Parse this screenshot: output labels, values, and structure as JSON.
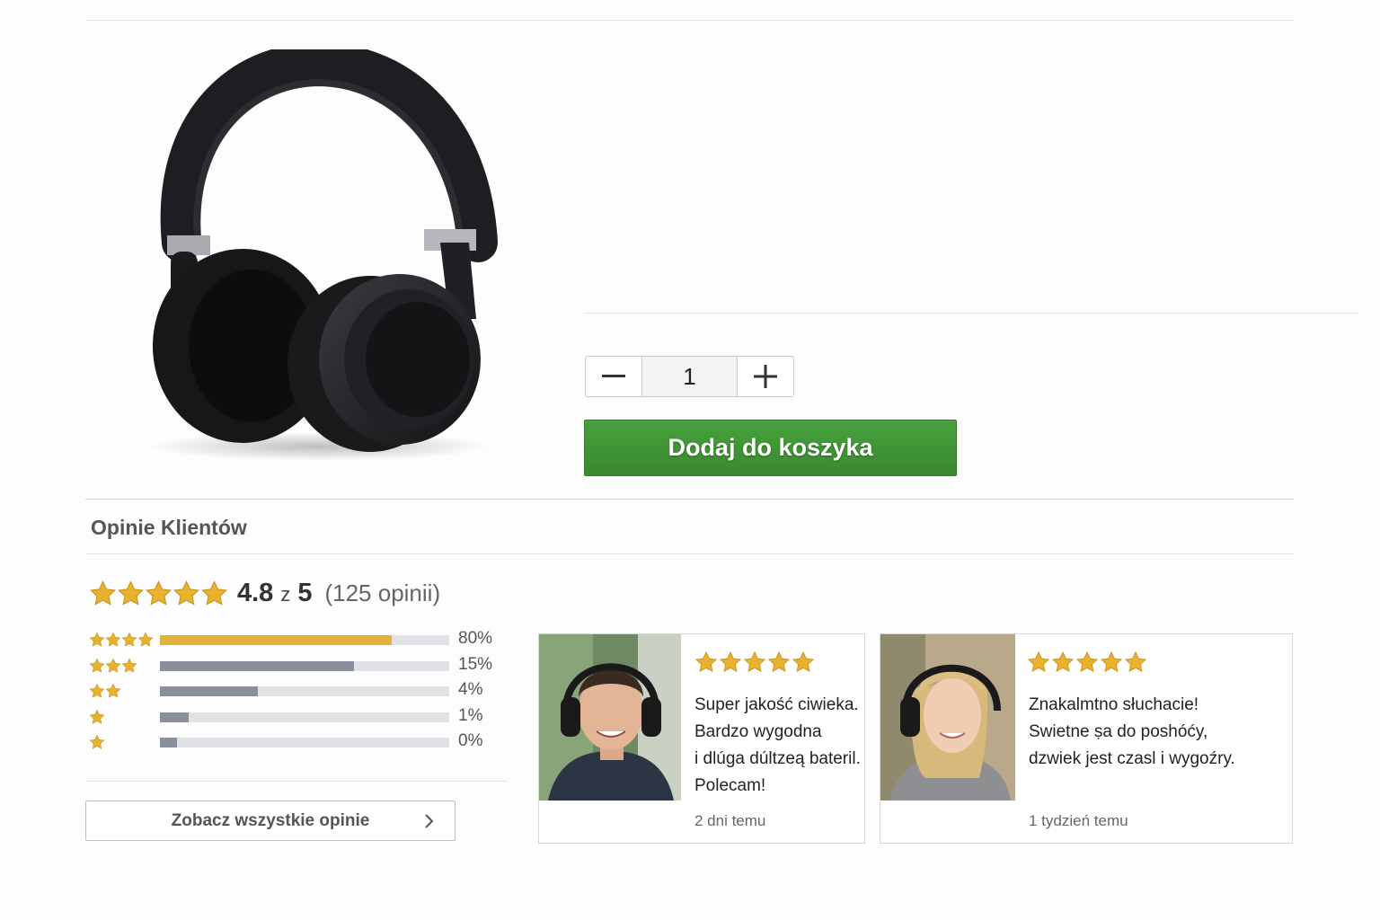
{
  "product": {
    "image_alt": "headphones",
    "quantity": "1",
    "decrement_symbol": "−",
    "increment_symbol": "+",
    "add_to_cart_label": "Dodaj do koszyka"
  },
  "reviews": {
    "section_title": "Opinie Klientów",
    "average": "4.8",
    "of_label": "z",
    "max": "5",
    "count_label": "(125 opinii)",
    "distribution": [
      {
        "stars": 4,
        "percent": 80,
        "label": "80%",
        "color": "#e2b23a"
      },
      {
        "stars": 3,
        "percent": 67,
        "label": "15%",
        "color": "#8a8f9c"
      },
      {
        "stars": 2,
        "percent": 34,
        "label": "4%",
        "color": "#8a8f9c"
      },
      {
        "stars": 1,
        "percent": 10,
        "label": "1%",
        "color": "#8a8f9c"
      },
      {
        "stars": 1,
        "percent": 6,
        "label": "0%",
        "color": "#8a8f9c"
      }
    ],
    "see_all_label": "Zobacz wszystkie opinie",
    "items": [
      {
        "rating": 5,
        "text": "Super jakość ciwieka.\nBardzo wygodna\ni dlúga dúltzeą bateril.\nPolecam!",
        "time": "2 dni temu"
      },
      {
        "rating": 5,
        "text": "Znakalmtno słuchacie!\nSwietne ṣa do poshóćy,\ndzwiek jest czasl i wygoźry.",
        "time": "1 tydzień temu"
      }
    ]
  },
  "colors": {
    "accent_green": "#3f9433",
    "star_gold": "#e9b22e",
    "bar_gray": "#8a8f9c"
  }
}
